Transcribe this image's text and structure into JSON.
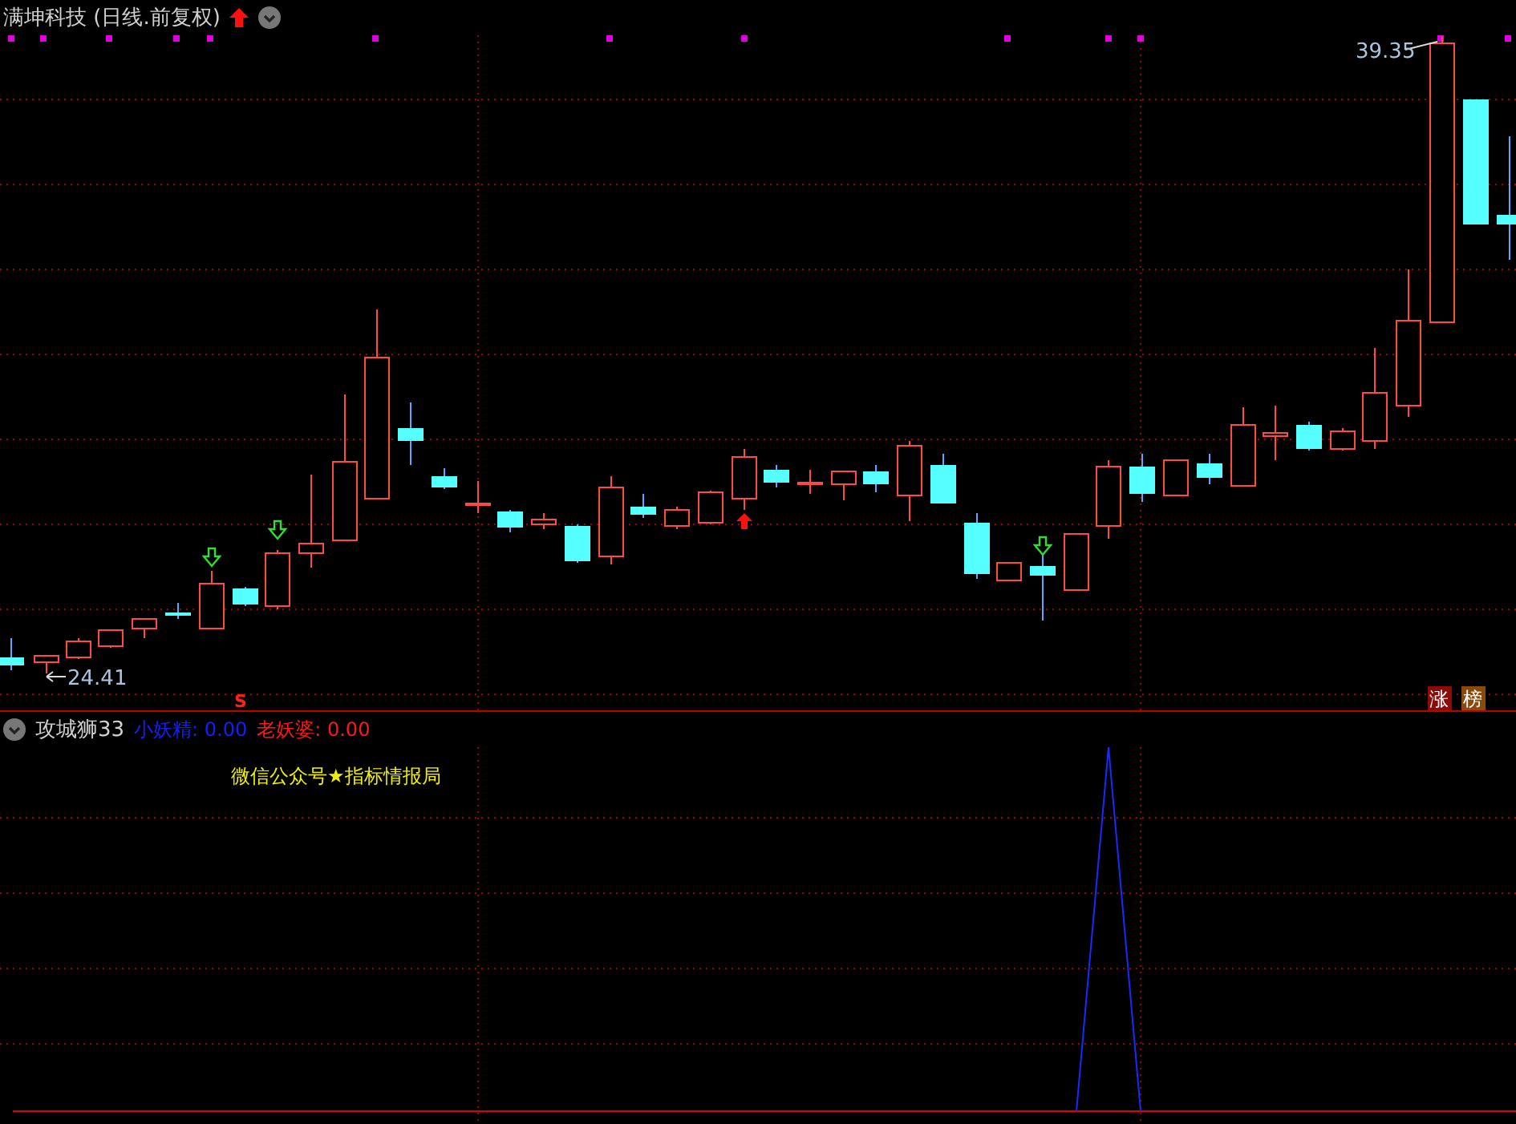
{
  "price_panel": {
    "title": "满坤科技 (日线.前复权)",
    "low_label": "24.41",
    "high_label": "39.35",
    "signal_label": "S",
    "badges": [
      {
        "text": "涨",
        "color": "#8b0a0a"
      },
      {
        "text": "榜",
        "color": "#8a4a0c"
      }
    ]
  },
  "indicator_panel": {
    "name": "攻城狮33",
    "values": [
      {
        "label": "小妖精: 0.00",
        "color": "#1020ff"
      },
      {
        "label": "老妖婆: 0.00",
        "color": "#ff1818"
      }
    ],
    "annotation": "微信公众号★指标情报局"
  }
}
